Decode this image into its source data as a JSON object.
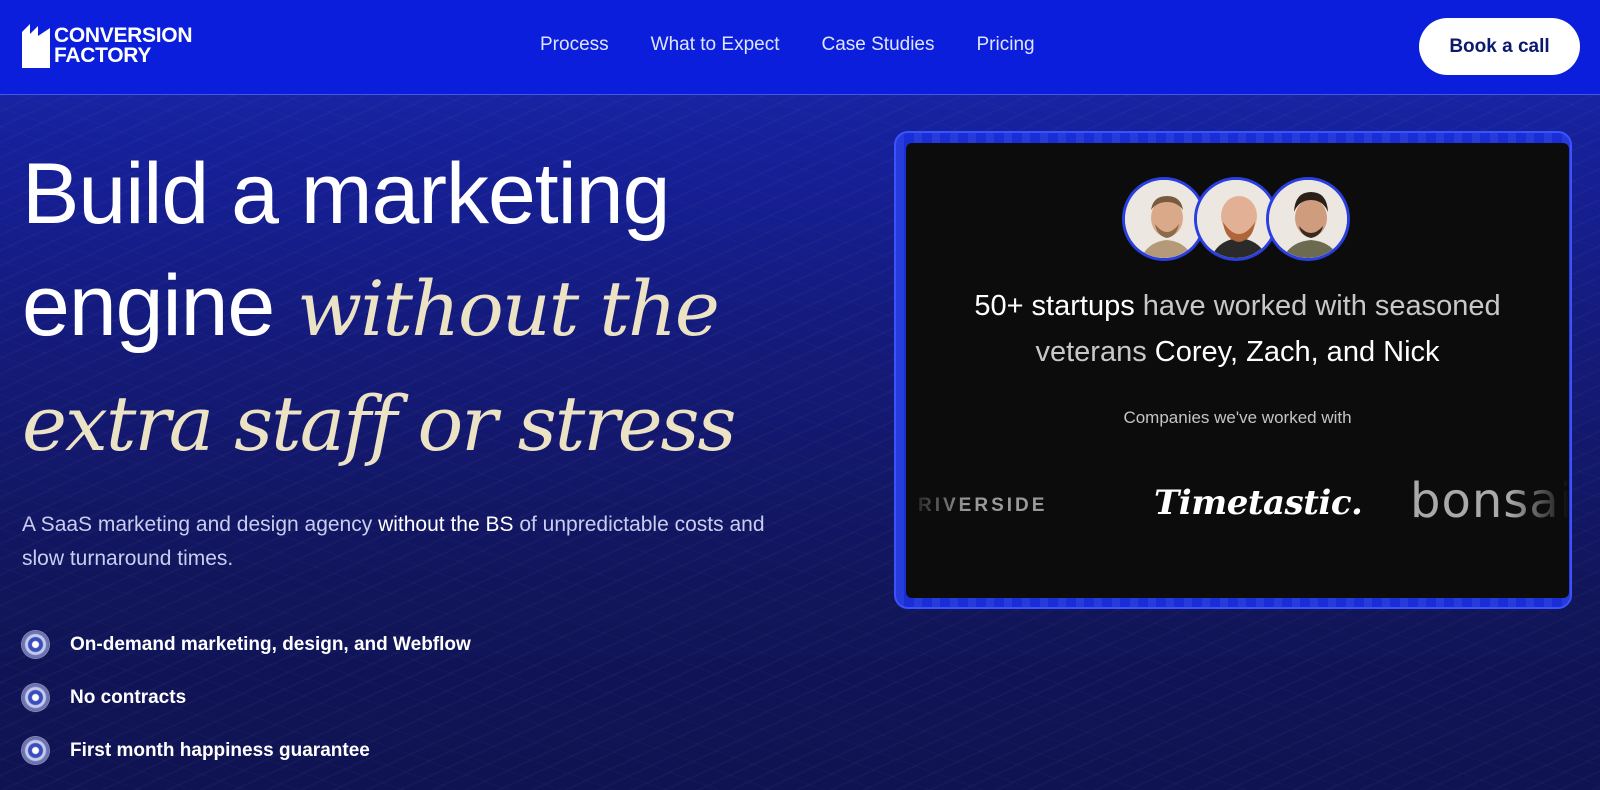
{
  "brand": {
    "line1": "CONVERSION",
    "line2": "FACTORY",
    "colors": {
      "header_bg": "#0a1edc",
      "accent_cream": "#ece2c4",
      "card_bg": "#0c0c0c"
    }
  },
  "nav": {
    "items": [
      {
        "label": "Process"
      },
      {
        "label": "What to Expect"
      },
      {
        "label": "Case Studies"
      },
      {
        "label": "Pricing"
      }
    ],
    "cta_label": "Book a call"
  },
  "hero": {
    "headline_sans_1": "Build a marketing",
    "headline_sans_2": "engine",
    "headline_serif_1": "without the",
    "headline_serif_2": "extra staff or stress",
    "sub_part1": "A SaaS marketing and design agency ",
    "sub_bold": "without the BS",
    "sub_part2": " of unpredictable costs and slow turnaround times.",
    "features": [
      {
        "label": "On-demand marketing, design, and Webflow",
        "icon": "target-bullet-icon"
      },
      {
        "label": "No contracts",
        "icon": "target-bullet-icon"
      },
      {
        "label": "First month happiness guarantee",
        "icon": "target-bullet-icon"
      }
    ]
  },
  "card": {
    "avatars": [
      "Corey",
      "Zach",
      "Nick"
    ],
    "title_bright_1": "50+ startups",
    "title_muted_1": " have worked with seasoned",
    "title_muted_2": "veterans ",
    "title_bright_2": "Corey, Zach, and Nick",
    "companies_label": "Companies we've worked with",
    "company_logos": [
      "RIVERSIDE",
      "Timetastic.",
      "bonsai"
    ]
  }
}
